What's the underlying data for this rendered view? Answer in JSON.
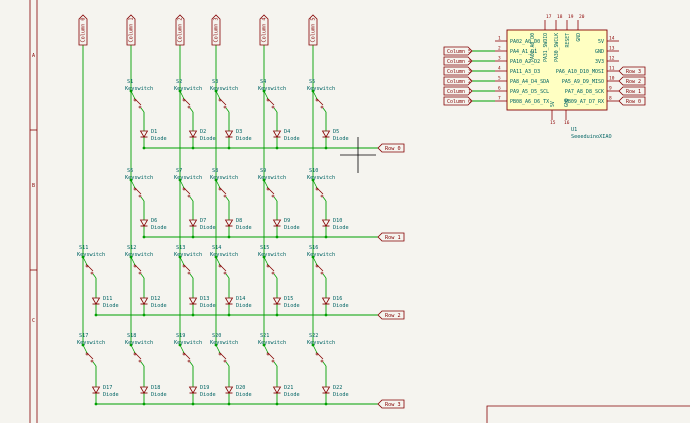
{
  "colors": {
    "background": "#f5f4ef",
    "wire": "#00a000",
    "symbol": "#840000",
    "label": "#006464",
    "pin": "#8c0000",
    "border": "#840000",
    "chip_fill": "#ffffc2",
    "cursor": "#000000"
  },
  "frame": {
    "row_markers": [
      "A",
      "B",
      "C"
    ]
  },
  "columns": [
    "Column 0",
    "Column 1",
    "Column 2",
    "Column 3",
    "Column 4",
    "Column 5"
  ],
  "rows": [
    "Row 0",
    "Row 1",
    "Row 2",
    "Row 3"
  ],
  "switches": [
    [
      "S1",
      "S2",
      "S3",
      "S4",
      "S5"
    ],
    [
      "S6",
      "S7",
      "S8",
      "S9",
      "S10"
    ],
    [
      "S11",
      "S12",
      "S13",
      "S14",
      "S15",
      "S16"
    ],
    [
      "S17",
      "S18",
      "S19",
      "S20",
      "S21",
      "S22"
    ]
  ],
  "diodes": [
    [
      "D1",
      "D2",
      "D3",
      "D4",
      "D5"
    ],
    [
      "D6",
      "D7",
      "D8",
      "D9",
      "D10"
    ],
    [
      "D11",
      "D12",
      "D13",
      "D14",
      "D15",
      "D16"
    ],
    [
      "D17",
      "D18",
      "D19",
      "D20",
      "D21",
      "D22"
    ]
  ],
  "switch_value": "Keyswitch",
  "diode_value": "Diode",
  "mcu": {
    "ref": "U1",
    "value": "SeeeduinoXIAO",
    "top_pins": [
      "PA02_A0_D0",
      "PA31_SWDIO",
      "PA30_SWCLK",
      "RESET",
      "GND"
    ],
    "left_pins": [
      {
        "num": "1",
        "name": "PA02_A0_D0"
      },
      {
        "num": "2",
        "name": "PA4_A1_D1",
        "net": "Column 5"
      },
      {
        "num": "3",
        "name": "PA10_A2_D2",
        "net": "Column 4"
      },
      {
        "num": "4",
        "name": "PA11_A3_D3",
        "net": "Column 3"
      },
      {
        "num": "5",
        "name": "PA8_A4_D4_SDA",
        "net": "Column 2"
      },
      {
        "num": "6",
        "name": "PA9_A5_D5_SCL",
        "net": "Column 1"
      },
      {
        "num": "7",
        "name": "PB08_A6_D6_TX",
        "net": "Column 0"
      }
    ],
    "right_pins": [
      {
        "num": "14",
        "name": "5V"
      },
      {
        "num": "13",
        "name": "GND"
      },
      {
        "num": "12",
        "name": "3V3"
      },
      {
        "num": "11",
        "name": "PA6_A10_D10_MOSI",
        "net": "Row 3"
      },
      {
        "num": "10",
        "name": "PA5_A9_D9_MISO",
        "net": "Row 2"
      },
      {
        "num": "9",
        "name": "PA7_A8_D8_SCK",
        "net": "Row 1"
      },
      {
        "num": "8",
        "name": "PB09_A7_D7_RX",
        "net": "Row 0"
      }
    ],
    "bottom_pins": [
      {
        "num": "15",
        "name": "5V"
      },
      {
        "num": "16",
        "name": "GND"
      }
    ],
    "top_pin_nums": [
      "17",
      "18",
      "19",
      "20"
    ]
  }
}
